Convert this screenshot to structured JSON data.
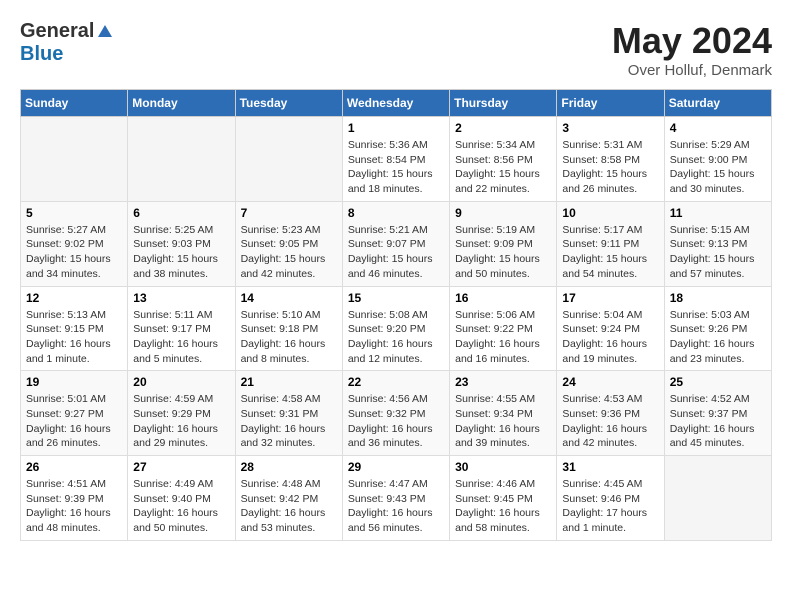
{
  "header": {
    "logo_general": "General",
    "logo_blue": "Blue",
    "title": "May 2024",
    "subtitle": "Over Holluf, Denmark"
  },
  "weekdays": [
    "Sunday",
    "Monday",
    "Tuesday",
    "Wednesday",
    "Thursday",
    "Friday",
    "Saturday"
  ],
  "weeks": [
    [
      {
        "day": "",
        "info": ""
      },
      {
        "day": "",
        "info": ""
      },
      {
        "day": "",
        "info": ""
      },
      {
        "day": "1",
        "info": "Sunrise: 5:36 AM\nSunset: 8:54 PM\nDaylight: 15 hours\nand 18 minutes."
      },
      {
        "day": "2",
        "info": "Sunrise: 5:34 AM\nSunset: 8:56 PM\nDaylight: 15 hours\nand 22 minutes."
      },
      {
        "day": "3",
        "info": "Sunrise: 5:31 AM\nSunset: 8:58 PM\nDaylight: 15 hours\nand 26 minutes."
      },
      {
        "day": "4",
        "info": "Sunrise: 5:29 AM\nSunset: 9:00 PM\nDaylight: 15 hours\nand 30 minutes."
      }
    ],
    [
      {
        "day": "5",
        "info": "Sunrise: 5:27 AM\nSunset: 9:02 PM\nDaylight: 15 hours\nand 34 minutes."
      },
      {
        "day": "6",
        "info": "Sunrise: 5:25 AM\nSunset: 9:03 PM\nDaylight: 15 hours\nand 38 minutes."
      },
      {
        "day": "7",
        "info": "Sunrise: 5:23 AM\nSunset: 9:05 PM\nDaylight: 15 hours\nand 42 minutes."
      },
      {
        "day": "8",
        "info": "Sunrise: 5:21 AM\nSunset: 9:07 PM\nDaylight: 15 hours\nand 46 minutes."
      },
      {
        "day": "9",
        "info": "Sunrise: 5:19 AM\nSunset: 9:09 PM\nDaylight: 15 hours\nand 50 minutes."
      },
      {
        "day": "10",
        "info": "Sunrise: 5:17 AM\nSunset: 9:11 PM\nDaylight: 15 hours\nand 54 minutes."
      },
      {
        "day": "11",
        "info": "Sunrise: 5:15 AM\nSunset: 9:13 PM\nDaylight: 15 hours\nand 57 minutes."
      }
    ],
    [
      {
        "day": "12",
        "info": "Sunrise: 5:13 AM\nSunset: 9:15 PM\nDaylight: 16 hours\nand 1 minute."
      },
      {
        "day": "13",
        "info": "Sunrise: 5:11 AM\nSunset: 9:17 PM\nDaylight: 16 hours\nand 5 minutes."
      },
      {
        "day": "14",
        "info": "Sunrise: 5:10 AM\nSunset: 9:18 PM\nDaylight: 16 hours\nand 8 minutes."
      },
      {
        "day": "15",
        "info": "Sunrise: 5:08 AM\nSunset: 9:20 PM\nDaylight: 16 hours\nand 12 minutes."
      },
      {
        "day": "16",
        "info": "Sunrise: 5:06 AM\nSunset: 9:22 PM\nDaylight: 16 hours\nand 16 minutes."
      },
      {
        "day": "17",
        "info": "Sunrise: 5:04 AM\nSunset: 9:24 PM\nDaylight: 16 hours\nand 19 minutes."
      },
      {
        "day": "18",
        "info": "Sunrise: 5:03 AM\nSunset: 9:26 PM\nDaylight: 16 hours\nand 23 minutes."
      }
    ],
    [
      {
        "day": "19",
        "info": "Sunrise: 5:01 AM\nSunset: 9:27 PM\nDaylight: 16 hours\nand 26 minutes."
      },
      {
        "day": "20",
        "info": "Sunrise: 4:59 AM\nSunset: 9:29 PM\nDaylight: 16 hours\nand 29 minutes."
      },
      {
        "day": "21",
        "info": "Sunrise: 4:58 AM\nSunset: 9:31 PM\nDaylight: 16 hours\nand 32 minutes."
      },
      {
        "day": "22",
        "info": "Sunrise: 4:56 AM\nSunset: 9:32 PM\nDaylight: 16 hours\nand 36 minutes."
      },
      {
        "day": "23",
        "info": "Sunrise: 4:55 AM\nSunset: 9:34 PM\nDaylight: 16 hours\nand 39 minutes."
      },
      {
        "day": "24",
        "info": "Sunrise: 4:53 AM\nSunset: 9:36 PM\nDaylight: 16 hours\nand 42 minutes."
      },
      {
        "day": "25",
        "info": "Sunrise: 4:52 AM\nSunset: 9:37 PM\nDaylight: 16 hours\nand 45 minutes."
      }
    ],
    [
      {
        "day": "26",
        "info": "Sunrise: 4:51 AM\nSunset: 9:39 PM\nDaylight: 16 hours\nand 48 minutes."
      },
      {
        "day": "27",
        "info": "Sunrise: 4:49 AM\nSunset: 9:40 PM\nDaylight: 16 hours\nand 50 minutes."
      },
      {
        "day": "28",
        "info": "Sunrise: 4:48 AM\nSunset: 9:42 PM\nDaylight: 16 hours\nand 53 minutes."
      },
      {
        "day": "29",
        "info": "Sunrise: 4:47 AM\nSunset: 9:43 PM\nDaylight: 16 hours\nand 56 minutes."
      },
      {
        "day": "30",
        "info": "Sunrise: 4:46 AM\nSunset: 9:45 PM\nDaylight: 16 hours\nand 58 minutes."
      },
      {
        "day": "31",
        "info": "Sunrise: 4:45 AM\nSunset: 9:46 PM\nDaylight: 17 hours\nand 1 minute."
      },
      {
        "day": "",
        "info": ""
      }
    ]
  ]
}
